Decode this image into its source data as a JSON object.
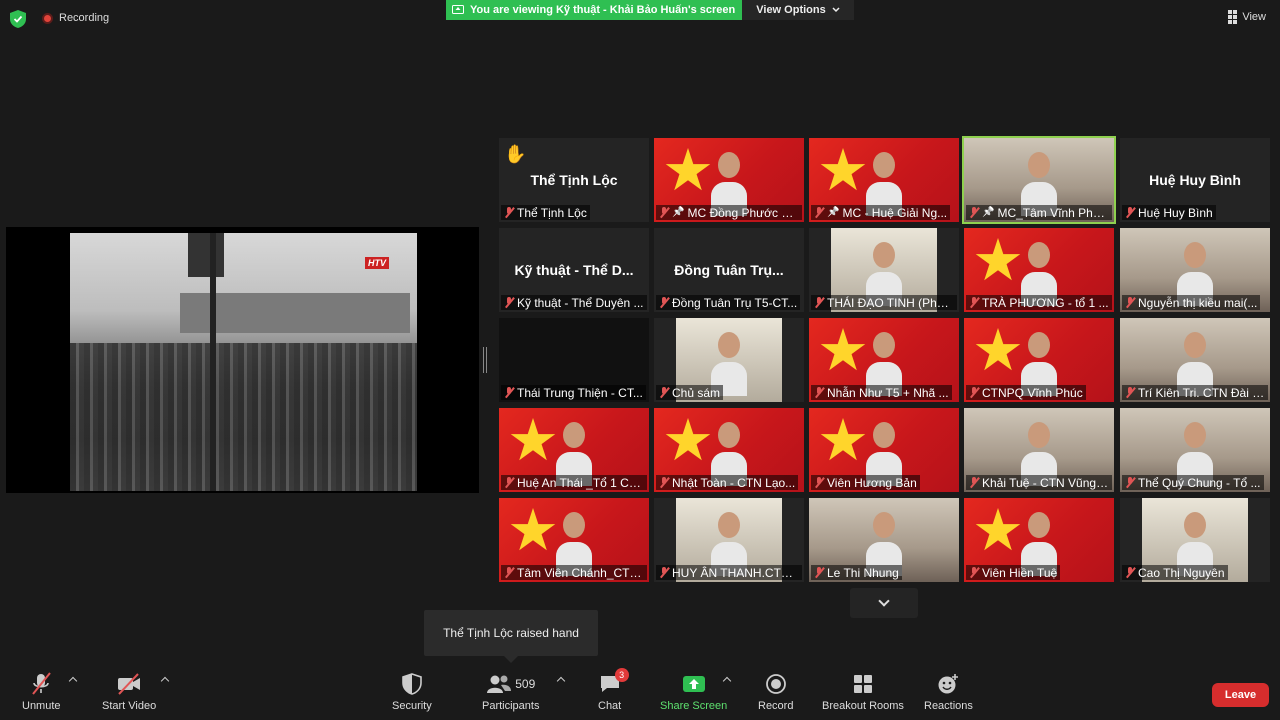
{
  "top": {
    "recording": "Recording",
    "banner": "You are viewing Kỹ thuật - Khải Bảo Huấn's screen",
    "view_options": "View Options",
    "view": "View"
  },
  "share": {
    "logo": "HTV"
  },
  "tiles": [
    {
      "label": "Thể Tịnh Lộc",
      "big": "Thể Tịnh Lộc",
      "hand": true,
      "bg": "dark"
    },
    {
      "label": "MC Đồng Phước Nghĩa",
      "bg": "flag",
      "pin": true
    },
    {
      "label": "MC - Huệ Giải Ng...",
      "bg": "flag",
      "pin": true
    },
    {
      "label": "MC_Tâm Vĩnh Pho...",
      "bg": "room",
      "pin": true,
      "active": true
    },
    {
      "label": "Huệ Huy Bình",
      "big": "Huệ Huy Bình",
      "bg": "dark"
    },
    {
      "label": "Kỹ thuật - Thể Duyên ...",
      "big": "Kỹ thuật - Thể D...",
      "bg": "dark"
    },
    {
      "label": "Đồng Tuân Trụ T5-CT...",
      "big": "Đồng Tuân Trụ...",
      "bg": "dark"
    },
    {
      "label": "THÁI ĐẠO TINH (Phật...",
      "bg": "photo"
    },
    {
      "label": "TRÀ PHƯƠNG - tổ 1 ...",
      "bg": "flag"
    },
    {
      "label": "Nguyễn thị kiều mai(...",
      "bg": "room"
    },
    {
      "label": "Thái Trung Thiện - CT...",
      "bg": "black"
    },
    {
      "label": "Chủ sám",
      "bg": "photo"
    },
    {
      "label": "Nhẫn Như T5 + Nhã ...",
      "bg": "flag"
    },
    {
      "label": "CTNPQ Vĩnh Phúc",
      "bg": "flag"
    },
    {
      "label": "Trí Kiên Tri. CTN Đài L...",
      "bg": "room"
    },
    {
      "label": "Huệ An Thái _Tổ 1 CT...",
      "bg": "flag"
    },
    {
      "label": "Nhật Toàn - CTN Lạo...",
      "bg": "flag"
    },
    {
      "label": "Viên Hương Bản",
      "bg": "flag"
    },
    {
      "label": "Khải Tuệ - CTN Vũng ...",
      "bg": "room"
    },
    {
      "label": "Thể Quý Chung - Tổ ...",
      "bg": "room"
    },
    {
      "label": "Tâm Viên Chánh_CTN...",
      "bg": "flag"
    },
    {
      "label": "HUY ÂN THANH.CTN ...",
      "bg": "photo"
    },
    {
      "label": "Le Thi Nhung",
      "bg": "room"
    },
    {
      "label": "Viên Hiền Tuệ",
      "bg": "flag"
    },
    {
      "label": "Cao Thị Nguyên",
      "bg": "photo"
    }
  ],
  "tooltip": "Thể Tịnh Lộc raised hand",
  "toolbar": {
    "unmute": "Unmute",
    "start_video": "Start Video",
    "security": "Security",
    "participants": "Participants",
    "participants_count": "509",
    "chat": "Chat",
    "chat_badge": "3",
    "share_screen": "Share Screen",
    "record": "Record",
    "breakout": "Breakout Rooms",
    "reactions": "Reactions",
    "leave": "Leave"
  },
  "colors": {
    "banner": "#2fbf52",
    "leave": "#d62d2d",
    "active_border": "#8fd14f"
  }
}
